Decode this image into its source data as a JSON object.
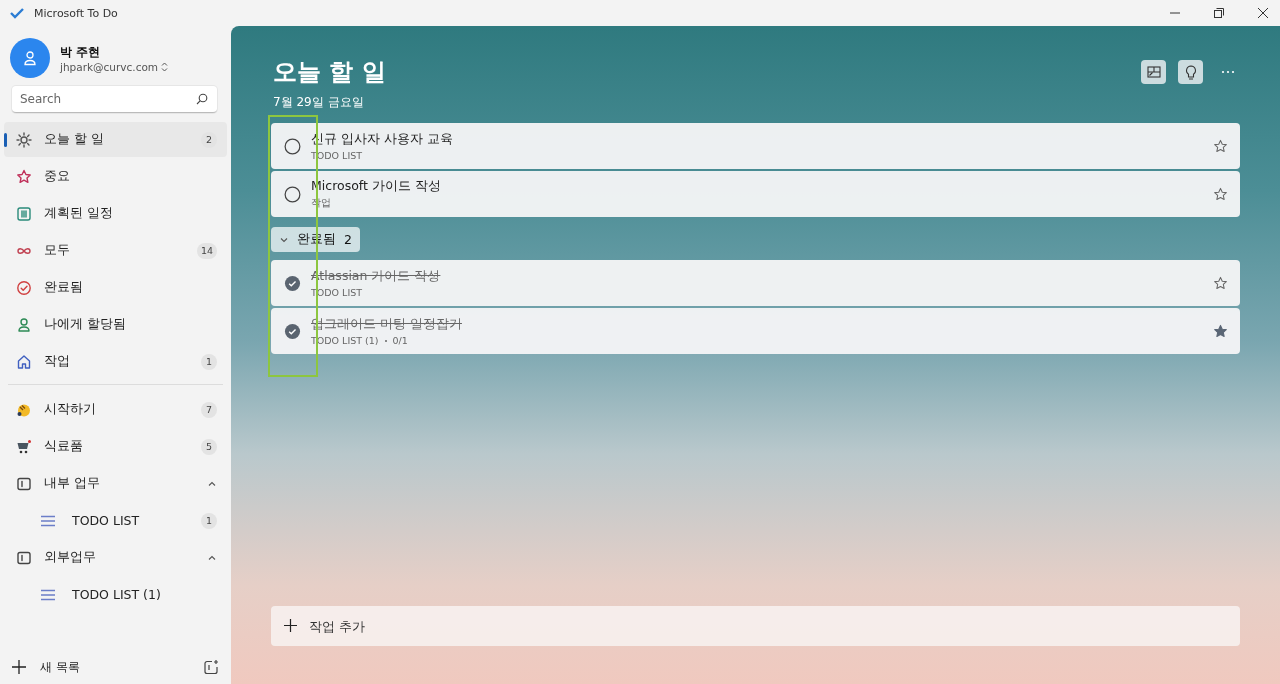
{
  "window": {
    "title": "Microsoft To Do"
  },
  "sidebar": {
    "user": {
      "name": "박 주현",
      "email": "jhpark@curvc.com"
    },
    "search": {
      "placeholder": "Search"
    },
    "smart_lists": [
      {
        "kind": "sun",
        "label": "오늘 할 일",
        "count": "2",
        "selected": true
      },
      {
        "kind": "star",
        "label": "중요",
        "selected": false
      },
      {
        "kind": "calendar",
        "label": "계획된 일정",
        "selected": false
      },
      {
        "kind": "infinity",
        "label": "모두",
        "count": "14",
        "selected": false
      },
      {
        "kind": "check",
        "label": "완료됨",
        "selected": false
      },
      {
        "kind": "person",
        "label": "나에게 할당됨",
        "selected": false
      },
      {
        "kind": "home",
        "label": "작업",
        "count": "1",
        "selected": false
      }
    ],
    "lists": [
      {
        "kind": "hands",
        "label": "시작하기",
        "count": "7",
        "selected": false
      },
      {
        "kind": "cart",
        "label": "식료품",
        "count": "5",
        "selected": false
      },
      {
        "kind": "group",
        "label": "내부 업무",
        "expanded": true,
        "children": [
          {
            "label": "TODO LIST",
            "count": "1",
            "selected": false
          }
        ]
      },
      {
        "kind": "group",
        "label": "외부업무",
        "expanded": true,
        "children": [
          {
            "label": "TODO LIST (1)",
            "selected": false
          }
        ]
      }
    ],
    "new_list": "새 목록"
  },
  "main": {
    "title": "오늘 할 일",
    "date": "7월 29일 금요일",
    "tasks": [
      {
        "title": "신규 입사자 사용자 교육",
        "list": "TODO LIST",
        "completed": false,
        "important": false
      },
      {
        "title": "Microsoft 가이드 작성",
        "list": "작업",
        "completed": false,
        "important": false
      }
    ],
    "completed_group": {
      "label": "완료됨",
      "count": "2",
      "expanded": true
    },
    "completed_tasks": [
      {
        "title": "Atlassian 가이드 작성",
        "list": "TODO LIST",
        "completed": true,
        "important": false
      },
      {
        "title": "업그레이드 미팅 일정잡기",
        "list": "TODO LIST (1)",
        "steps": "0/1",
        "completed": true,
        "important": true
      }
    ],
    "add_task": {
      "placeholder": "작업 추가"
    }
  }
}
